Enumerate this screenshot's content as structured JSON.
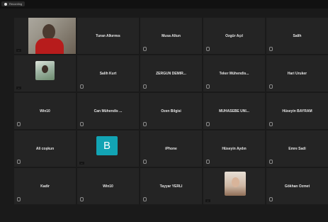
{
  "recording": {
    "label": "Recording"
  },
  "participants": [
    {
      "name": "",
      "type": "video",
      "sub": "...",
      "mic": false
    },
    {
      "name": "Turan Alkırmıs",
      "type": "name",
      "mic": false
    },
    {
      "name": "Musa Altun",
      "type": "name",
      "mic": true
    },
    {
      "name": "Özgür Açıl",
      "type": "name",
      "mic": true
    },
    {
      "name": "Salih",
      "type": "name",
      "mic": true
    },
    {
      "name": "",
      "type": "photo",
      "sub": "...",
      "mic": false
    },
    {
      "name": "Salih Kurt",
      "type": "name",
      "mic": true
    },
    {
      "name": "ZERGÜN DEMİR...",
      "type": "name",
      "mic": true
    },
    {
      "name": "Teker Mühendis...",
      "type": "name",
      "mic": true
    },
    {
      "name": "Hari Uruker",
      "type": "name",
      "mic": true
    },
    {
      "name": "Win10",
      "type": "name",
      "mic": true
    },
    {
      "name": "Can Mühendis ...",
      "type": "name",
      "mic": true
    },
    {
      "name": "Özen Bilgisi",
      "type": "name",
      "mic": true
    },
    {
      "name": "MUHASEBE ÜNİ...",
      "type": "name",
      "mic": true
    },
    {
      "name": "Hüseyin BAYRAM",
      "type": "name",
      "mic": true
    },
    {
      "name": "Ali coşkun",
      "type": "name",
      "mic": true
    },
    {
      "name": "",
      "type": "avatar",
      "initial": "B",
      "sub": "...",
      "mic": false
    },
    {
      "name": "iPhone",
      "type": "name",
      "mic": true
    },
    {
      "name": "Hüseyin Aydın",
      "type": "name",
      "mic": true
    },
    {
      "name": "Emre Sadi",
      "type": "name",
      "mic": true
    },
    {
      "name": "Kadir",
      "type": "name",
      "mic": true
    },
    {
      "name": "Win10",
      "type": "name",
      "mic": true
    },
    {
      "name": "Tayyar YERLİ",
      "type": "name",
      "mic": true
    },
    {
      "name": "",
      "type": "face",
      "sub": "...",
      "mic": false
    },
    {
      "name": "Gökhan Özmet",
      "type": "name",
      "mic": true
    }
  ]
}
